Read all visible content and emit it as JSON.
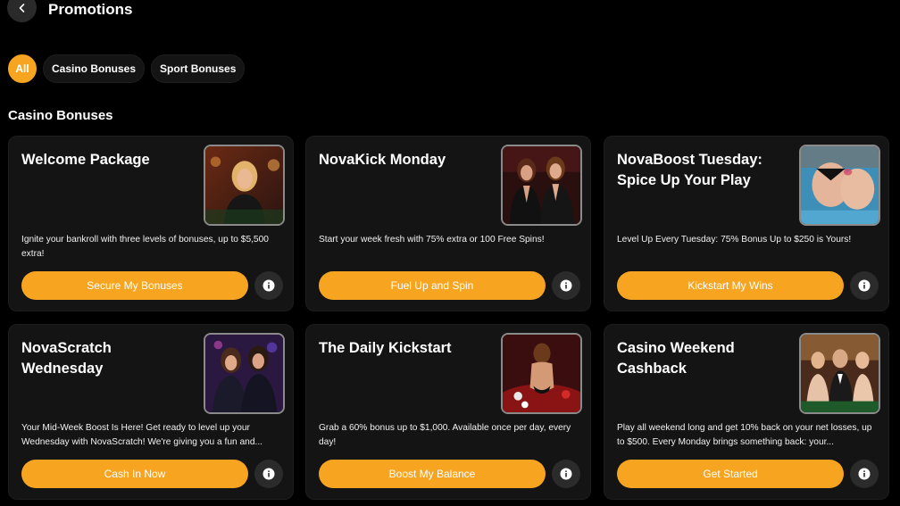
{
  "header": {
    "title": "Promotions"
  },
  "filters": [
    {
      "label": "All",
      "active": true
    },
    {
      "label": "Casino Bonuses",
      "active": false
    },
    {
      "label": "Sport Bonuses",
      "active": false
    }
  ],
  "section": {
    "title": "Casino Bonuses"
  },
  "colors": {
    "accent": "#f7a521",
    "card_bg": "#141414",
    "page_bg": "#000000"
  },
  "cards": [
    {
      "title": "Welcome Package",
      "description": "Ignite your bankroll with three levels of bonuses, up to $5,500 extra!",
      "cta": "Secure My Bonuses",
      "image": "casino-host-photo"
    },
    {
      "title": "NovaKick Monday",
      "description": "Start your week fresh with 75% extra or 100 Free Spins!",
      "cta": "Fuel Up and Spin",
      "image": "two-women-photo"
    },
    {
      "title": "NovaBoost Tuesday: Spice Up Your Play",
      "description": "Level Up Every Tuesday: 75% Bonus Up to $250 is Yours!",
      "cta": "Kickstart My Wins",
      "image": "pool-photo"
    },
    {
      "title": "NovaScratch Wednesday",
      "description": "Your Mid-Week Boost Is Here! Get ready to level up your Wednesday with NovaScratch! We're giving you a fun and...",
      "cta": "Cash In Now",
      "image": "party-women-photo"
    },
    {
      "title": "The Daily Kickstart",
      "description": "Grab a 60% bonus up to $1,000. Available once per day, every day!",
      "cta": "Boost My Balance",
      "image": "poker-table-photo"
    },
    {
      "title": "Casino Weekend Cashback",
      "description": "Play all weekend long and get 10% back on your net losses, up to $500. Every Monday brings something back: your...",
      "cta": "Get Started",
      "image": "casino-party-photo"
    }
  ]
}
